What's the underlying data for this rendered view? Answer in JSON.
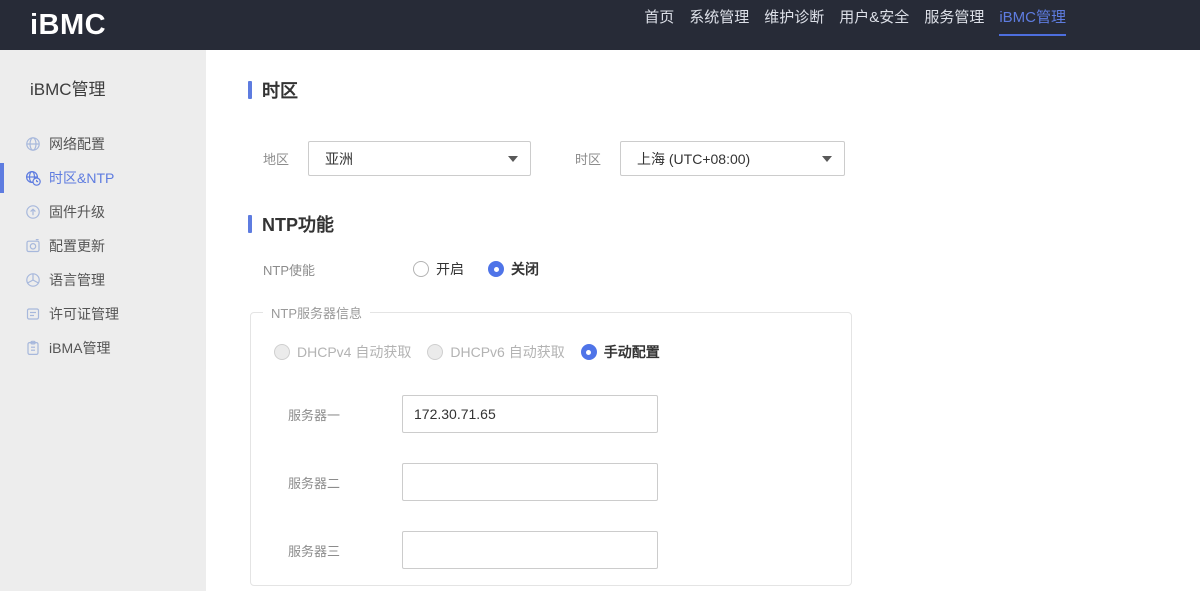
{
  "colors": {
    "accent": "#5e7ce0",
    "topbar_bg": "#272b37",
    "sidebar_bg": "#ededed",
    "radio_checked": "#4f74e8"
  },
  "brand": {
    "logo": "iBMC"
  },
  "topnav": {
    "items": [
      {
        "label": "首页",
        "active": false
      },
      {
        "label": "系统管理",
        "active": false
      },
      {
        "label": "维护诊断",
        "active": false
      },
      {
        "label": "用户&安全",
        "active": false
      },
      {
        "label": "服务管理",
        "active": false
      },
      {
        "label": "iBMC管理",
        "active": true
      }
    ]
  },
  "sidebar": {
    "title": "iBMC管理",
    "items": [
      {
        "label": "网络配置",
        "icon": "network-globe-icon",
        "active": false
      },
      {
        "label": "时区&NTP",
        "icon": "timezone-clock-icon",
        "active": true
      },
      {
        "label": "固件升级",
        "icon": "firmware-upload-icon",
        "active": false
      },
      {
        "label": "配置更新",
        "icon": "config-update-icon",
        "active": false
      },
      {
        "label": "语言管理",
        "icon": "language-globe-icon",
        "active": false
      },
      {
        "label": "许可证管理",
        "icon": "license-doc-icon",
        "active": false
      },
      {
        "label": "iBMA管理",
        "icon": "ibma-clipboard-icon",
        "active": false
      }
    ],
    "collapse": {
      "icon": "chevron-left-icon"
    }
  },
  "main": {
    "timezone_section": {
      "title": "时区",
      "region_label": "地区",
      "region_value": "亚洲",
      "timezone_label": "时区",
      "timezone_value": "上海 (UTC+08:00)"
    },
    "ntp_section": {
      "title": "NTP功能",
      "enable_label": "NTP使能",
      "enable_options": [
        {
          "label": "开启",
          "selected": false
        },
        {
          "label": "关闭",
          "selected": true
        }
      ],
      "server_group": {
        "legend": "NTP服务器信息",
        "mode_options": [
          {
            "label": "DHCPv4 自动获取",
            "selected": false,
            "disabled": true
          },
          {
            "label": "DHCPv6 自动获取",
            "selected": false,
            "disabled": true
          },
          {
            "label": "手动配置",
            "selected": true,
            "disabled": false
          }
        ],
        "servers": [
          {
            "label": "服务器一",
            "value": "172.30.71.65"
          },
          {
            "label": "服务器二",
            "value": ""
          },
          {
            "label": "服务器三",
            "value": ""
          }
        ]
      }
    }
  }
}
